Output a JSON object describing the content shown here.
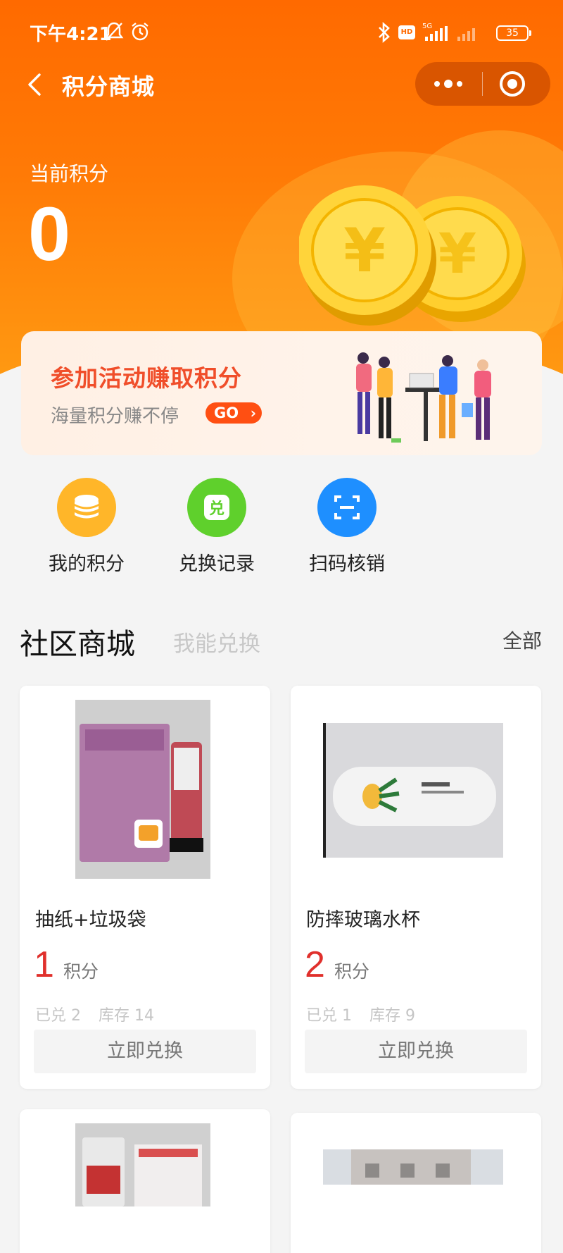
{
  "status_bar": {
    "time": "下午4:21",
    "network": "5G",
    "hd": "HD",
    "battery": "35"
  },
  "nav": {
    "title": "积分商城",
    "back_icon": "chevron-left-icon",
    "more_icon": "more-dots-icon",
    "close_icon": "target-icon"
  },
  "points": {
    "label": "当前积分",
    "value": "0"
  },
  "banner": {
    "title": "参加活动赚取积分",
    "subtitle": "海量积分赚不停",
    "go_label": "GO"
  },
  "quick_actions": [
    {
      "label": "我的积分",
      "icon": "coins-stack-icon",
      "color": "#ffb629"
    },
    {
      "label": "兑换记录",
      "icon": "redeem-icon",
      "color": "#5fd02c",
      "glyph": "兑"
    },
    {
      "label": "扫码核销",
      "icon": "scan-icon",
      "color": "#1e8fff"
    }
  ],
  "section": {
    "title": "社区商城",
    "tab2": "我能兑换",
    "all": "全部"
  },
  "products": [
    {
      "name": "抽纸+垃圾袋",
      "points": "1",
      "unit": "积分",
      "redeemed": "已兑 2",
      "stock": "库存 14",
      "button": "立即兑换"
    },
    {
      "name": "防摔玻璃水杯",
      "points": "2",
      "unit": "积分",
      "redeemed": "已兑 1",
      "stock": "库存 9",
      "button": "立即兑换"
    }
  ],
  "colors": {
    "primary": "#ff6a00",
    "price_red": "#e0302c",
    "banner_title": "#f04e2a"
  }
}
